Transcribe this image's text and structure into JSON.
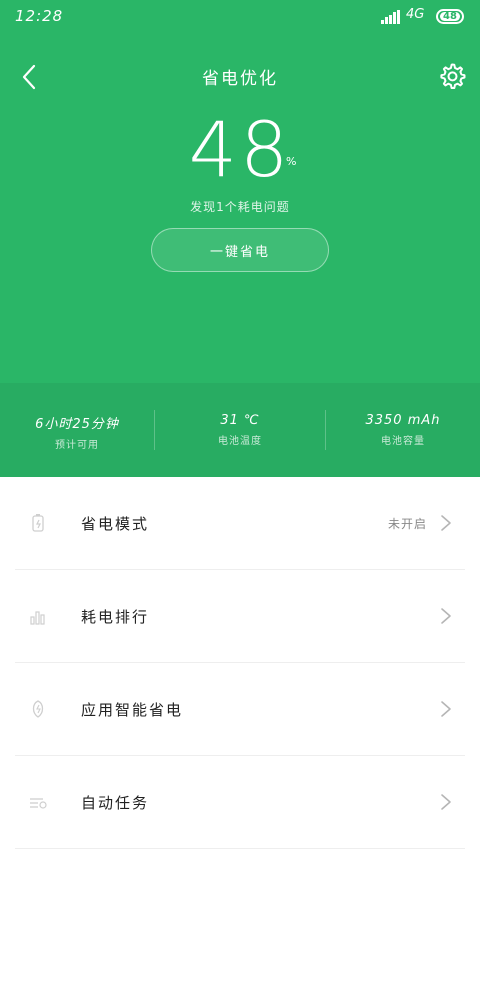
{
  "status_bar": {
    "time": "12:28",
    "network": "4G",
    "battery": "48"
  },
  "header": {
    "title": "省电优化",
    "battery_percent": "48",
    "battery_unit": "%",
    "issue_text": "发现1个耗电问题",
    "optimize_label": "一键省电"
  },
  "stats": [
    {
      "value": "6小时25分钟",
      "label": "预计可用"
    },
    {
      "value": "31 ℃",
      "label": "电池温度"
    },
    {
      "value": "3350 mAh",
      "label": "电池容量"
    }
  ],
  "menu": [
    {
      "label": "省电模式",
      "value": "未开启",
      "icon": "battery-mode-icon"
    },
    {
      "label": "耗电排行",
      "value": "",
      "icon": "bar-chart-icon"
    },
    {
      "label": "应用智能省电",
      "value": "",
      "icon": "leaf-icon"
    },
    {
      "label": "自动任务",
      "value": "",
      "icon": "task-switch-icon"
    }
  ],
  "colors": {
    "primary": "#2ab667",
    "stats_bg": "#28ac62"
  }
}
